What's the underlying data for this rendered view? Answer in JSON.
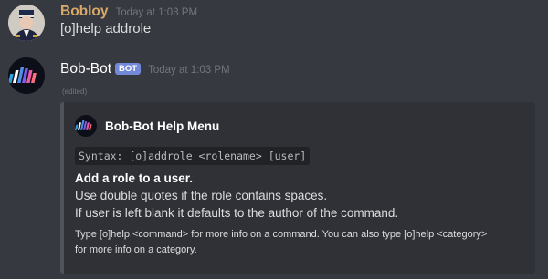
{
  "messages": [
    {
      "author": "Bobloy",
      "timestamp": "Today at 1:03 PM",
      "content": "[o]help addrole",
      "author_color": "#d8aa6a"
    },
    {
      "author": "Bob-Bot",
      "badge": "BOT",
      "timestamp": "Today at 1:03 PM",
      "edited": "(edited)",
      "embed": {
        "author_name": "Bob-Bot Help Menu",
        "author_icon": "bar-logo-icon",
        "syntax": "Syntax: [o]addrole <rolename> [user]",
        "field_name": "Add a role to a user.",
        "field_lines": [
          "Use double quotes if the role contains spaces.",
          "If user is left blank it defaults to the author of the command."
        ],
        "footer_lines": [
          "Type [o]help <command> for more info on a command. You can also type [o]help <category>",
          "for more info on a category."
        ]
      }
    }
  ],
  "colors": {
    "background": "#36393f",
    "embed_background": "#2f3136",
    "bot_badge": "#7289da",
    "timestamp": "#72767d"
  }
}
